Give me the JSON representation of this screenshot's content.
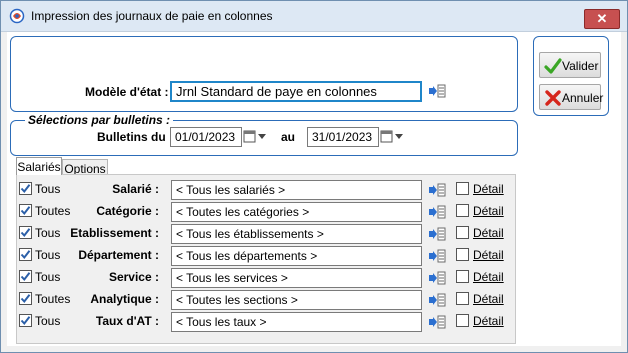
{
  "window": {
    "title": "Impression des journaux de paie en colonnes",
    "close_glyph": "✕"
  },
  "model": {
    "label": "Modèle d'état :",
    "value": "Jrnl Standard de paye en colonnes"
  },
  "selections": {
    "legend": "Sélections par bulletins :",
    "from_label": "Bulletins du",
    "from_value": "01/01/2023",
    "to_label": "au",
    "to_value": "31/01/2023"
  },
  "tabs": [
    {
      "label": "Salariés",
      "active": true
    },
    {
      "label": "Options",
      "active": false
    }
  ],
  "rows": [
    {
      "all_label": "Tous",
      "label": "Salarié :",
      "value": "< Tous les salariés >",
      "detail": "Détail",
      "all_checked": true,
      "detail_checked": false
    },
    {
      "all_label": "Toutes",
      "label": "Catégorie :",
      "value": "< Toutes les catégories >",
      "detail": "Détail",
      "all_checked": true,
      "detail_checked": false
    },
    {
      "all_label": "Tous",
      "label": "Etablissement :",
      "value": "< Tous les établissements >",
      "detail": "Détail",
      "all_checked": true,
      "detail_checked": false
    },
    {
      "all_label": "Tous",
      "label": "Département :",
      "value": "< Tous les départements >",
      "detail": "Détail",
      "all_checked": true,
      "detail_checked": false
    },
    {
      "all_label": "Tous",
      "label": "Service :",
      "value": "< Tous les services >",
      "detail": "Détail",
      "all_checked": true,
      "detail_checked": false
    },
    {
      "all_label": "Toutes",
      "label": "Analytique :",
      "value": "< Toutes les sections >",
      "detail": "Détail",
      "all_checked": true,
      "detail_checked": false
    },
    {
      "all_label": "Tous",
      "label": "Taux d'AT :",
      "value": "< Tous les taux >",
      "detail": "Détail",
      "all_checked": true,
      "detail_checked": false
    }
  ],
  "buttons": {
    "validate": "Valider",
    "cancel": "Annuler"
  },
  "colors": {
    "accent_border": "#2c6cb8",
    "focus_border": "#1f86c9",
    "check": "#2b5fa8"
  },
  "icons": {
    "list": "list-select-icon",
    "calendar": "calendar-icon",
    "validate": "green-check-icon",
    "cancel": "red-x-icon"
  }
}
